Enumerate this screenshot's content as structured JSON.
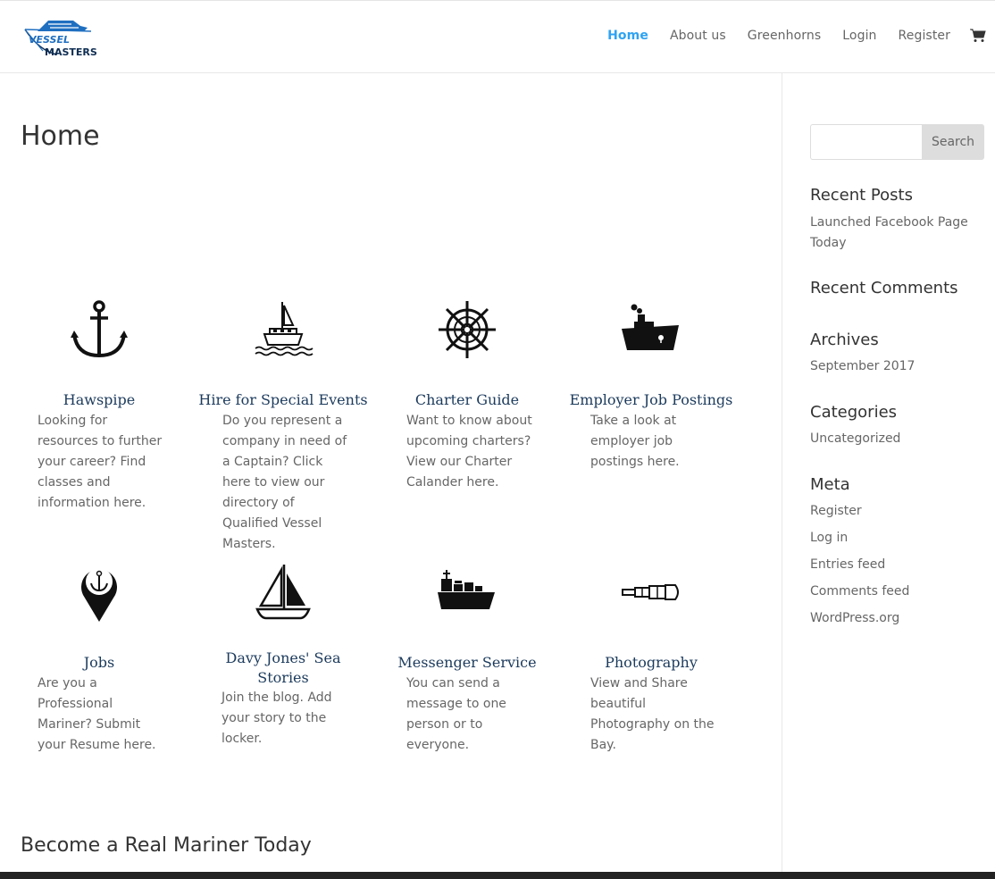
{
  "header": {
    "logo_line1": "VESSEL",
    "logo_line2": "MASTERS",
    "nav": [
      "Home",
      "About us",
      "Greenhorns",
      "Login",
      "Register"
    ],
    "cart_icon": "cart-icon"
  },
  "main": {
    "page_title": "Home",
    "section_title": "Become a Real Mariner Today",
    "features": [
      {
        "icon": "anchor-icon",
        "title": "Hawspipe",
        "desc": "Looking for resources to further your career? Find classes and information here."
      },
      {
        "icon": "sailboat-ferry-icon",
        "title": "Hire for Special Events",
        "desc": "Do you represent a company in need of a Captain? Click here to view our directory of Qualified Vessel Masters."
      },
      {
        "icon": "ship-wheel-icon",
        "title": "Charter Guide",
        "desc": "Want to know about upcoming charters? View our Charter Calander here."
      },
      {
        "icon": "steamship-icon",
        "title": "Employer Job Postings",
        "desc": "Take a look at employer job postings here."
      },
      {
        "icon": "anchor-pin-icon",
        "title": "Jobs",
        "desc": "Are you a Professional Mariner? Submit your Resume here."
      },
      {
        "icon": "sailboat-icon",
        "title": "Davy Jones' Sea Stories",
        "desc": "Join the blog. Add your story to the locker."
      },
      {
        "icon": "cargo-ship-icon",
        "title": "Messenger Service",
        "desc": "You can send a message to one person or to everyone."
      },
      {
        "icon": "spyglass-icon",
        "title": "Photography",
        "desc": "View and Share beautiful Photography on the Bay."
      }
    ]
  },
  "sidebar": {
    "search_button": "Search",
    "recent_posts_title": "Recent Posts",
    "recent_posts": [
      "Launched Facebook Page Today"
    ],
    "recent_comments_title": "Recent Comments",
    "archives_title": "Archives",
    "archives": [
      "September 2017"
    ],
    "categories_title": "Categories",
    "categories": [
      "Uncategorized"
    ],
    "meta_title": "Meta",
    "meta": [
      "Register",
      "Log in",
      "Entries feed",
      "Comments feed",
      "WordPress.org"
    ]
  }
}
